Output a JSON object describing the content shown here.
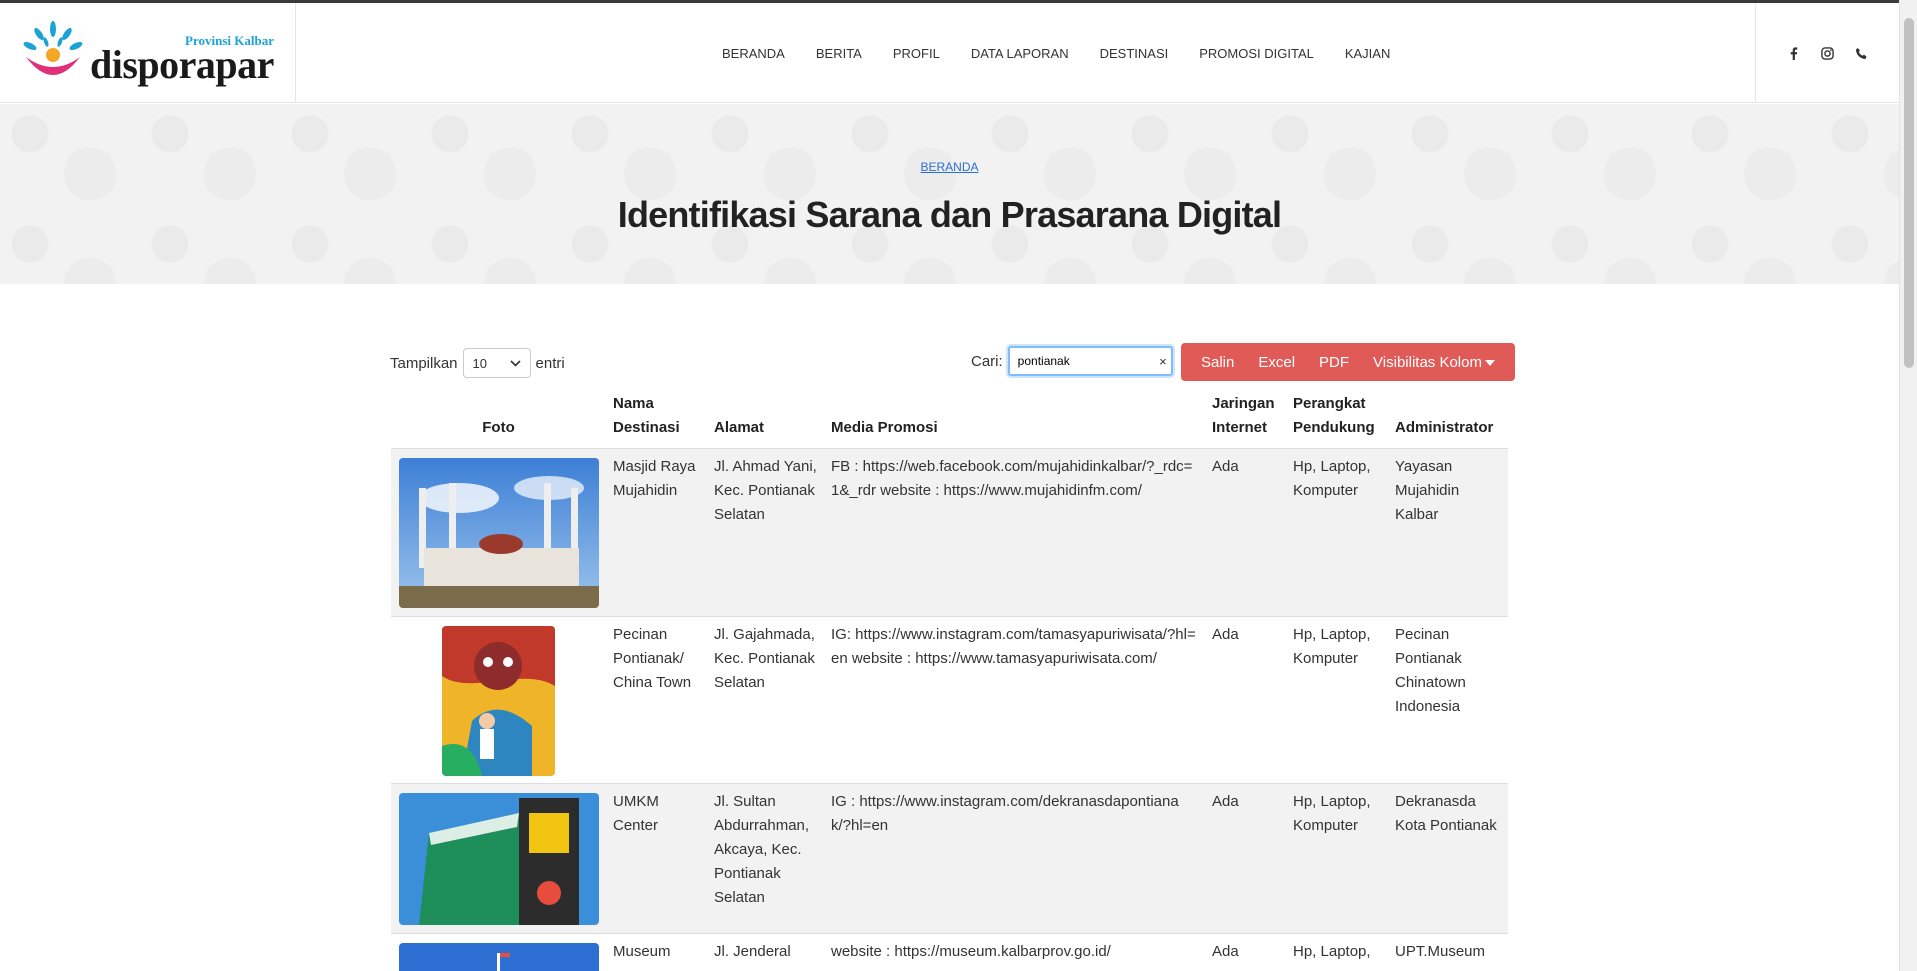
{
  "brand": {
    "province": "Provinsi Kalbar",
    "name": "disporapar"
  },
  "nav": {
    "items": [
      "BERANDA",
      "BERITA",
      "PROFIL",
      "DATA LAPORAN",
      "DESTINASI",
      "PROMOSI DIGITAL",
      "KAJIAN"
    ]
  },
  "social": {
    "icons": [
      "facebook-icon",
      "instagram-icon",
      "phone-icon"
    ]
  },
  "hero": {
    "breadcrumb": "BERANDA",
    "title": "Identifikasi Sarana dan Prasarana Digital"
  },
  "controls": {
    "show_label": "Tampilkan",
    "show_value": "10",
    "entries_label": "entri",
    "search_label": "Cari:",
    "search_value": "pontianak",
    "clear": "×",
    "buttons": {
      "copy": "Salin",
      "excel": "Excel",
      "pdf": "PDF",
      "colvis": "Visibilitas Kolom"
    }
  },
  "table": {
    "headers": {
      "foto": "Foto",
      "nama": [
        "Nama",
        "Destinasi"
      ],
      "alamat": "Alamat",
      "media": "Media Promosi",
      "jaringan": [
        "Jaringan",
        "Internet"
      ],
      "perangkat": [
        "Perangkat",
        "Pendukung"
      ],
      "admin": "Administrator"
    },
    "rows": [
      {
        "nama": "Masjid Raya Mujahidin",
        "alamat": "Jl. Ahmad Yani, Kec. Pontianak Selatan",
        "media": "FB : https://web.facebook.com/mujahidinkalbar/?_rdc=1&_rdr website : https://www.mujahidinfm.com/",
        "jaringan": "Ada",
        "perangkat": "Hp, Laptop, Komputer",
        "admin": "Yayasan Mujahidin Kalbar"
      },
      {
        "nama": "Pecinan Pontianak/ China Town",
        "alamat": "Jl. Gajahmada, Kec. Pontianak Selatan",
        "media": "IG: https://www.instagram.com/tamasyapuriwisata/?hl=en website : https://www.tamasyapuriwisata.com/",
        "jaringan": "Ada",
        "perangkat": "Hp, Laptop, Komputer",
        "admin": "Pecinan Pontianak Chinatown Indonesia"
      },
      {
        "nama": "UMKM Center",
        "alamat": "Jl. Sultan Abdurrahman, Akcaya, Kec. Pontianak Selatan",
        "media": "IG : https://www.instagram.com/dekranasdapontianak/?hl=en",
        "jaringan": "Ada",
        "perangkat": "Hp, Laptop, Komputer",
        "admin": "Dekranasda Kota Pontianak"
      },
      {
        "nama": "Museum",
        "alamat": "Jl. Jenderal",
        "media": "website : https://museum.kalbarprov.go.id/",
        "jaringan": "Ada",
        "perangkat": "Hp, Laptop,",
        "admin": "UPT.Museum"
      }
    ]
  },
  "colors": {
    "accent": "#e05a57",
    "link": "#2a6fd1",
    "logo_blue": "#1ba3d6"
  }
}
